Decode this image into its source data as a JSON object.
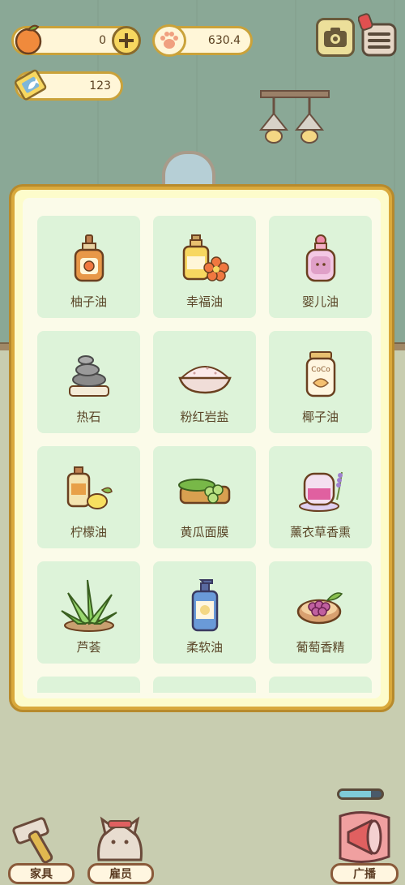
{
  "hud": {
    "apples": "0",
    "paws": "630.4",
    "tickets": "123"
  },
  "items": [
    {
      "name": "柚子油",
      "icon": "grapefruit-oil-icon"
    },
    {
      "name": "幸福油",
      "icon": "happiness-oil-icon"
    },
    {
      "name": "婴儿油",
      "icon": "baby-oil-icon"
    },
    {
      "name": "热石",
      "icon": "hot-stone-icon"
    },
    {
      "name": "粉红岩盐",
      "icon": "pink-rock-salt-icon"
    },
    {
      "name": "椰子油",
      "icon": "coconut-oil-icon"
    },
    {
      "name": "柠檬油",
      "icon": "lemon-oil-icon"
    },
    {
      "name": "黄瓜面膜",
      "icon": "cucumber-mask-icon"
    },
    {
      "name": "薰衣草香熏",
      "icon": "lavender-aroma-icon"
    },
    {
      "name": "芦荟",
      "icon": "aloe-icon"
    },
    {
      "name": "柔软油",
      "icon": "soft-oil-icon"
    },
    {
      "name": "葡萄香精",
      "icon": "grape-essence-icon"
    }
  ],
  "coconut_jar_text": "CoCo",
  "bottom": {
    "furniture": "家具",
    "staff": "雇员",
    "broadcast": "广播"
  },
  "progress": 0.75,
  "colors": {
    "wall": "#8aa896",
    "modal_border": "#d9a93c",
    "card_bg": "#ddf3d9"
  }
}
